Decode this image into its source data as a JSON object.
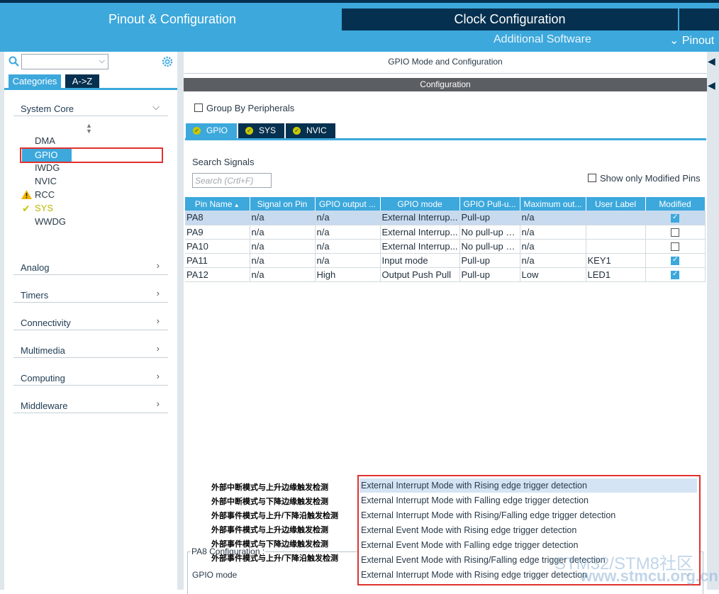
{
  "top_tabs": {
    "pinout": "Pinout & Configuration",
    "clock": "Clock Configuration",
    "additional_software": "Additional Software",
    "pinout_menu": "Pinout"
  },
  "sidebar": {
    "view_tabs": [
      "Categories",
      "A->Z"
    ],
    "categories": [
      {
        "label": "System Core",
        "expanded": true
      },
      {
        "label": "Analog",
        "expanded": false
      },
      {
        "label": "Timers",
        "expanded": false
      },
      {
        "label": "Connectivity",
        "expanded": false
      },
      {
        "label": "Multimedia",
        "expanded": false
      },
      {
        "label": "Computing",
        "expanded": false
      },
      {
        "label": "Middleware",
        "expanded": false
      }
    ],
    "system_core_items": [
      {
        "label": "DMA",
        "status": "none"
      },
      {
        "label": "GPIO",
        "status": "selected"
      },
      {
        "label": "IWDG",
        "status": "none"
      },
      {
        "label": "NVIC",
        "status": "none"
      },
      {
        "label": "RCC",
        "status": "warning"
      },
      {
        "label": "SYS",
        "status": "ok"
      },
      {
        "label": "WWDG",
        "status": "none"
      }
    ]
  },
  "main": {
    "title": "GPIO Mode and Configuration",
    "config_header": "Configuration",
    "group_by_peripherals": "Group By Peripherals",
    "peripheral_tabs": [
      "GPIO",
      "SYS",
      "NVIC"
    ],
    "search_label": "Search Signals",
    "search_placeholder": "Search (Crtl+F)",
    "show_modified": "Show only Modified Pins",
    "table": {
      "headers": [
        "Pin Name",
        "Signal on Pin",
        "GPIO output ...",
        "GPIO mode",
        "GPIO Pull-u...",
        "Maximum out...",
        "User Label",
        "Modified"
      ],
      "rows": [
        {
          "pin": "PA8",
          "signal": "n/a",
          "output": "n/a",
          "mode": "External Interrup...",
          "pull": "Pull-up",
          "speed": "n/a",
          "label": "",
          "modified": true
        },
        {
          "pin": "PA9",
          "signal": "n/a",
          "output": "n/a",
          "mode": "External Interrup...",
          "pull": "No pull-up a...",
          "speed": "n/a",
          "label": "",
          "modified": false
        },
        {
          "pin": "PA10",
          "signal": "n/a",
          "output": "n/a",
          "mode": "External Interrup...",
          "pull": "No pull-up a...",
          "speed": "n/a",
          "label": "",
          "modified": false
        },
        {
          "pin": "PA11",
          "signal": "n/a",
          "output": "n/a",
          "mode": "Input mode",
          "pull": "Pull-up",
          "speed": "n/a",
          "label": "KEY1",
          "modified": true
        },
        {
          "pin": "PA12",
          "signal": "n/a",
          "output": "High",
          "mode": "Output Push Pull",
          "pull": "Pull-up",
          "speed": "Low",
          "label": "LED1",
          "modified": true
        }
      ]
    },
    "pin_config_title": "PA8 Configuration :",
    "gpio_mode_label": "GPIO mode",
    "gpio_mode_options": [
      "External Interrupt Mode with Rising edge trigger detection",
      "External Interrupt Mode with Falling edge trigger detection",
      "External Interrupt Mode with Rising/Falling edge trigger detection",
      "External Event Mode with Rising edge trigger detection",
      "External Event Mode with Falling edge trigger detection",
      "External Event Mode with Rising/Falling edge trigger detection"
    ],
    "gpio_mode_selected": "External Interrupt Mode with Rising edge trigger detection",
    "annotations": [
      "外部中断模式与上升边缘触发检测",
      "外部中断模式与下降边缘触发检测",
      "外部事件模式与上升/下降沿触发检测",
      "外部事件模式与上升边缘触发检测",
      "外部事件模式与下降边缘触发检测",
      "外部事件模式与上升/下降沿触发检测"
    ]
  },
  "watermark": {
    "text": "STM32/STM8社区",
    "url": "www.stmcu.org.cn"
  },
  "colors": {
    "accent": "#3ca8dc",
    "dark_navy": "#06304f",
    "highlight_red": "#e0322f",
    "ok_yellow": "#c8c800"
  }
}
